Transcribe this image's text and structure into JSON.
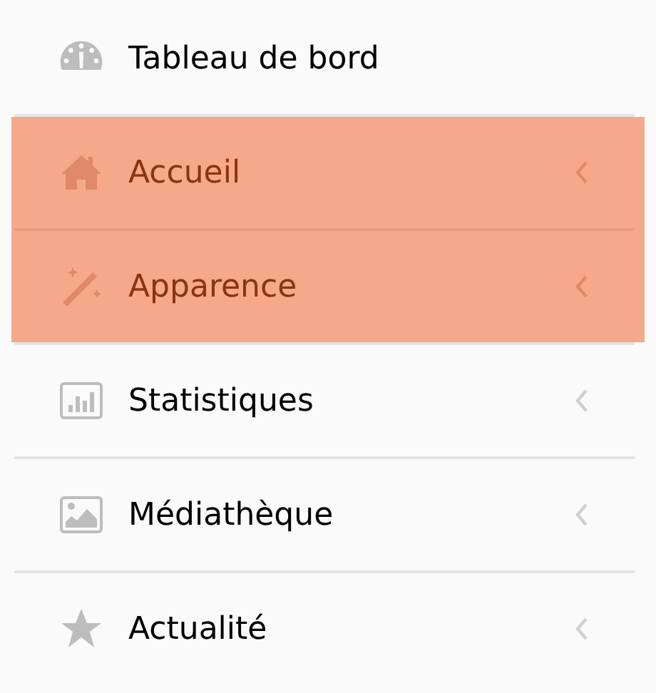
{
  "menu": [
    {
      "label": "Tableau de bord",
      "selected": false,
      "has_submenu": false
    },
    {
      "label": "Accueil",
      "selected": true,
      "has_submenu": true
    },
    {
      "label": "Apparence",
      "selected": true,
      "has_submenu": true
    },
    {
      "label": "Statistiques",
      "selected": false,
      "has_submenu": true
    },
    {
      "label": "Médiathèque",
      "selected": false,
      "has_submenu": true
    },
    {
      "label": "Actualité",
      "selected": false,
      "has_submenu": true
    }
  ]
}
